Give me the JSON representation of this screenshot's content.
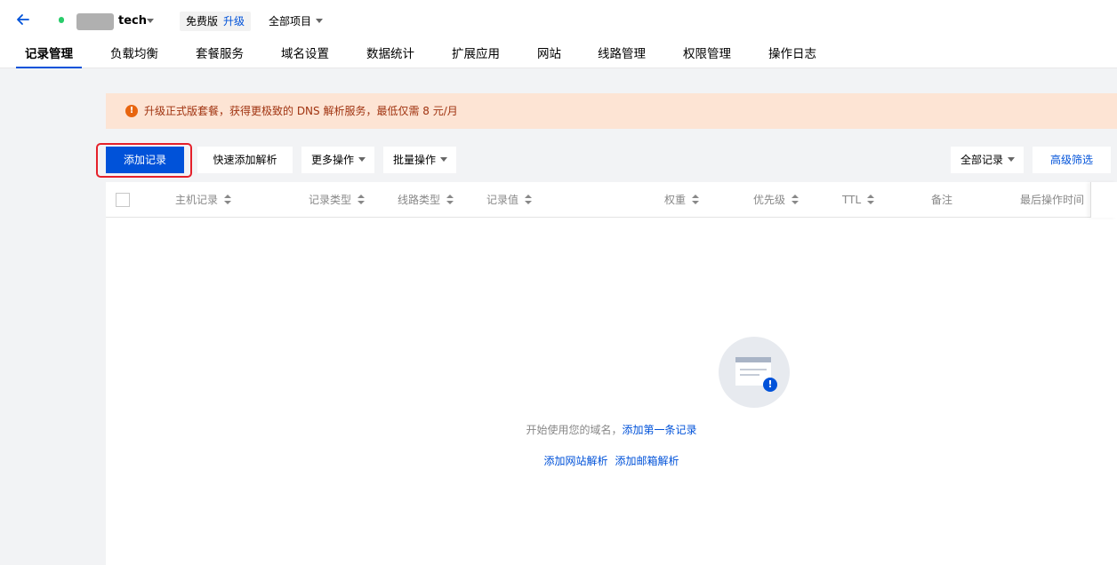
{
  "header": {
    "domain_suffix": "tech",
    "plan_label": "免费版",
    "upgrade_label": "升级",
    "project_select": "全部项目"
  },
  "tabs": [
    {
      "label": "记录管理",
      "active": true
    },
    {
      "label": "负载均衡"
    },
    {
      "label": "套餐服务"
    },
    {
      "label": "域名设置"
    },
    {
      "label": "数据统计"
    },
    {
      "label": "扩展应用"
    },
    {
      "label": "网站"
    },
    {
      "label": "线路管理"
    },
    {
      "label": "权限管理"
    },
    {
      "label": "操作日志"
    }
  ],
  "notice": {
    "icon": "info-icon",
    "text": "升级正式版套餐，获得更极致的 DNS 解析服务，最低仅需 8 元/月"
  },
  "toolbar": {
    "add_record": "添加记录",
    "quick_add": "快速添加解析",
    "more_actions": "更多操作",
    "batch_actions": "批量操作",
    "record_filter": "全部记录",
    "advanced_filter": "高级筛选"
  },
  "table": {
    "columns": [
      "主机记录",
      "记录类型",
      "线路类型",
      "记录值",
      "权重",
      "优先级",
      "TTL",
      "备注",
      "最后操作时间"
    ],
    "rows": []
  },
  "empty_state": {
    "text": "开始使用您的域名，",
    "first_record_link": "添加第一条记录",
    "add_site_link": "添加网站解析",
    "add_mail_link": "添加邮箱解析"
  },
  "colors": {
    "primary": "#0052d9",
    "notice_bg": "#fde4d4",
    "notice_text": "#a03310",
    "highlight": "#e5202a",
    "status_dot": "#29cc6a"
  }
}
